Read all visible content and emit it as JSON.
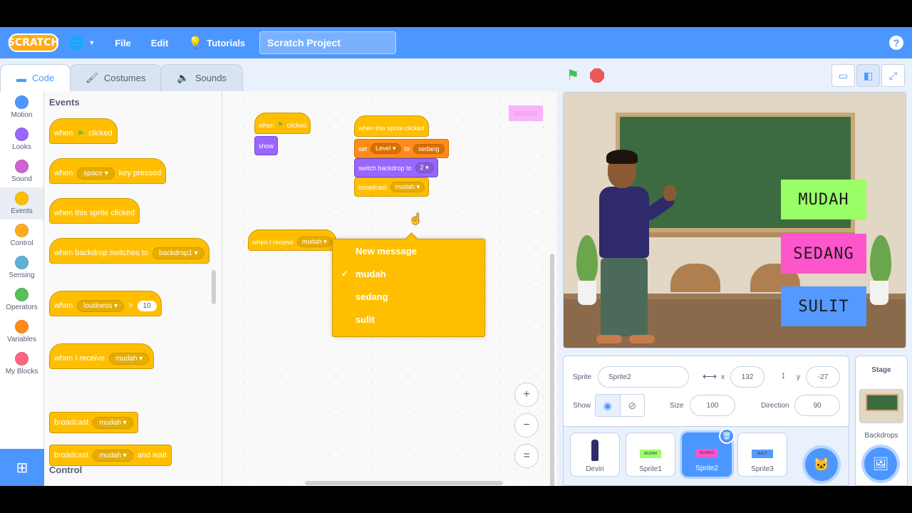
{
  "menu": {
    "logo": "SCRATCH",
    "file": "File",
    "edit": "Edit",
    "tutorials": "Tutorials",
    "project_title": "Scratch Project",
    "help": "?"
  },
  "tabs": [
    {
      "label": "Code",
      "icon": "code-icon"
    },
    {
      "label": "Costumes",
      "icon": "brush-icon"
    },
    {
      "label": "Sounds",
      "icon": "speaker-icon"
    }
  ],
  "categories": [
    {
      "label": "Motion",
      "color": "#4c97ff"
    },
    {
      "label": "Looks",
      "color": "#9966ff"
    },
    {
      "label": "Sound",
      "color": "#cf63cf"
    },
    {
      "label": "Events",
      "color": "#ffbf00"
    },
    {
      "label": "Control",
      "color": "#ffab19"
    },
    {
      "label": "Sensing",
      "color": "#5cb1d6"
    },
    {
      "label": "Operators",
      "color": "#59c059"
    },
    {
      "label": "Variables",
      "color": "#ff8c1a"
    },
    {
      "label": "My Blocks",
      "color": "#ff6680"
    }
  ],
  "palette": {
    "heading": "Events",
    "heading2": "Control",
    "when": "when",
    "clicked": "clicked",
    "space": "space",
    "key_pressed": "key pressed",
    "sprite_clicked": "when this sprite clicked",
    "backdrop_switches": "when backdrop switches to",
    "backdrop1": "backdrop1",
    "loudness": "loudness",
    "gt": ">",
    "ten": "10",
    "when_receive": "when I receive",
    "mudah": "mudah",
    "broadcast": "broadcast",
    "and_wait": "and wait"
  },
  "workspace": {
    "when": "when",
    "clicked": "clicked",
    "show": "show",
    "sprite_clicked": "when this sprite clicked",
    "set": "set",
    "level": "Level",
    "to": "to",
    "sedang": "sedang",
    "switch_backdrop": "switch backdrop to",
    "two": "2",
    "broadcast": "broadcast",
    "mudah": "mudah",
    "when_receive": "when I receive",
    "badge": "SEDANG",
    "zoom_in": "+",
    "zoom_out": "−",
    "zoom_reset": "="
  },
  "dropdown": {
    "items": [
      "New message",
      "mudah",
      "sedang",
      "sulit"
    ],
    "checked": "mudah",
    "check_mark": "✓"
  },
  "stage": {
    "buttons": [
      "MUDAH",
      "SEDANG",
      "SULIT"
    ],
    "colors": {
      "mudah": "#99ff66",
      "sedang": "#ff55cc",
      "sulit": "#5599ff"
    }
  },
  "sprite_info": {
    "sprite_label": "Sprite",
    "sprite_name": "Sprite2",
    "x_label": "x",
    "x_value": "132",
    "y_label": "y",
    "y_value": "-27",
    "show_label": "Show",
    "size_label": "Size",
    "size_value": "100",
    "direction_label": "Direction",
    "direction_value": "90"
  },
  "sprites": [
    {
      "name": "Devin"
    },
    {
      "name": "Sprite1",
      "thumb": "MUDAH"
    },
    {
      "name": "Sprite2",
      "thumb": "SEDANG"
    },
    {
      "name": "Sprite3",
      "thumb": "SULIT"
    }
  ],
  "stage_panel": {
    "title": "Stage",
    "backdrops": "Backdrops"
  }
}
